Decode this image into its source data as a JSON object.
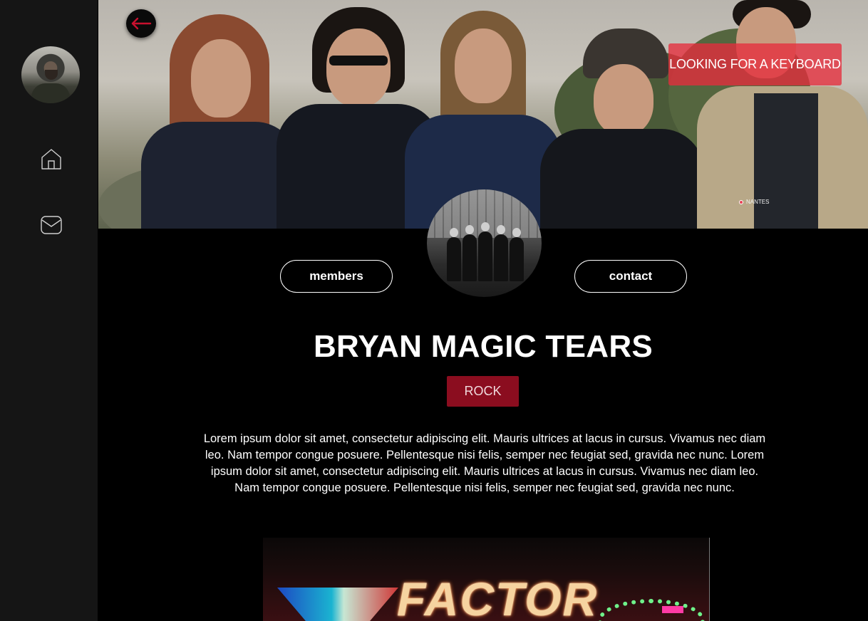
{
  "sidebar": {
    "avatar_alt": "",
    "items": [
      {
        "name": "home",
        "icon": "home-icon"
      },
      {
        "name": "messages",
        "icon": "mail-icon"
      }
    ]
  },
  "hero": {
    "back_icon": "arrow-left-icon",
    "looking_for": "LOOKING FOR A KEYBOARD",
    "location": "NANTES"
  },
  "actions": {
    "members_label": "members",
    "contact_label": "contact"
  },
  "band": {
    "name": "BRYAN MAGIC TEARS",
    "genre": "ROCK",
    "description": "Lorem ipsum dolor sit amet, consectetur adipiscing elit. Mauris ultrices at lacus in cursus. Vivamus nec diam leo. Nam tempor congue posuere. Pellentesque nisi felis, semper nec feugiat sed, gravida nec nunc. Lorem ipsum dolor sit amet, consectetur adipiscing elit. Mauris ultrices at lacus in cursus. Vivamus nec diam leo. Nam tempor congue posuere. Pellentesque nisi felis, semper nec feugiat sed, gravida nec nunc."
  },
  "gallery": {
    "sign_text": "FACTOR"
  },
  "colors": {
    "accent_red": "#8b0d1f",
    "badge_red": "#e62d3c",
    "sidebar_bg": "#151515"
  }
}
